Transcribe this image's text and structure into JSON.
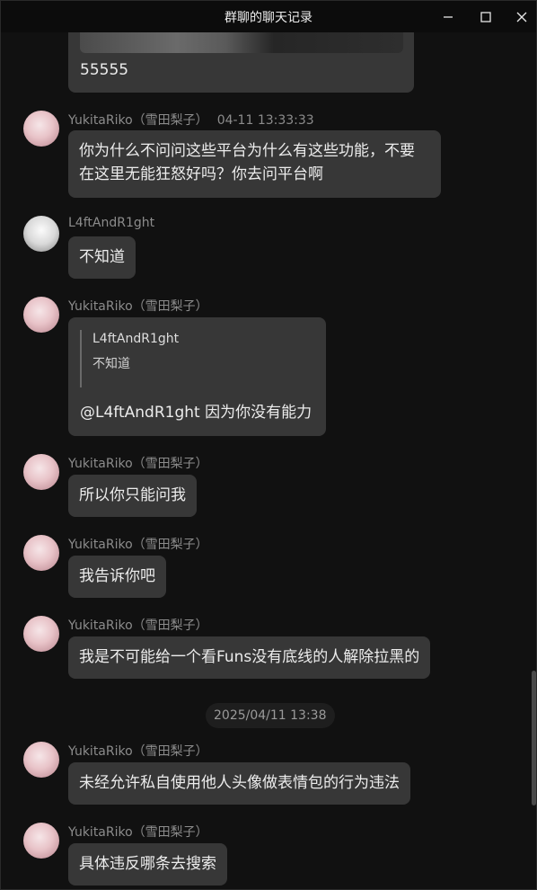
{
  "window": {
    "title": "群聊的聊天记录",
    "controls": {
      "minimize": "—",
      "maximize": "☐",
      "close": "✕"
    }
  },
  "messages": [
    {
      "type": "image_and_text",
      "text": "55555"
    },
    {
      "sender": "YukitaRiko（雪田梨子）",
      "time": "04-11 13:33:33",
      "avatar": "pink",
      "text_lines": [
        "你为什么不问问这些平台为什么有这些功能，不要",
        "在这里无能狂怒好吗？你去问平台啊"
      ]
    },
    {
      "sender": "L4ftAndR1ght",
      "avatar": "gray",
      "text": "不知道"
    },
    {
      "sender": "YukitaRiko（雪田梨子）",
      "avatar": "pink",
      "quote": {
        "name": "L4ftAndR1ght",
        "text": "不知道"
      },
      "text": "@L4ftAndR1ght 因为你没有能力"
    },
    {
      "sender": "YukitaRiko（雪田梨子）",
      "avatar": "pink",
      "text": "所以你只能问我"
    },
    {
      "sender": "YukitaRiko（雪田梨子）",
      "avatar": "pink",
      "text": "我告诉你吧"
    },
    {
      "sender": "YukitaRiko（雪田梨子）",
      "avatar": "pink",
      "text": "我是不可能给一个看Funs没有底线的人解除拉黑的"
    },
    {
      "sender": "YukitaRiko（雪田梨子）",
      "avatar": "pink",
      "text": "未经允许私自使用他人头像做表情包的行为违法"
    },
    {
      "sender": "YukitaRiko（雪田梨子）",
      "avatar": "pink",
      "text": "具体违反哪条去搜索"
    }
  ],
  "time_divider": "2025/04/11 13:38"
}
